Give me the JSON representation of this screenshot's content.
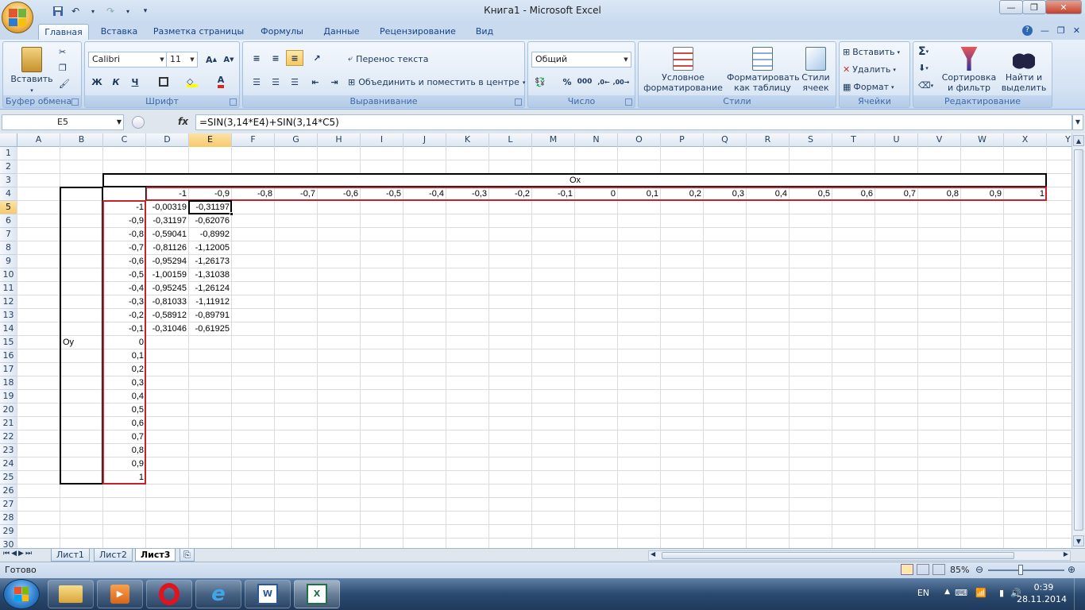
{
  "window": {
    "title": "Книга1 - Microsoft Excel"
  },
  "tabs": [
    "Главная",
    "Вставка",
    "Разметка страницы",
    "Формулы",
    "Данные",
    "Рецензирование",
    "Вид"
  ],
  "ribbon": {
    "clipboard": {
      "label": "Буфер обмена",
      "paste": "Вставить"
    },
    "font": {
      "label": "Шрифт",
      "name": "Calibri",
      "size": "11",
      "bold": "Ж",
      "italic": "К",
      "underline": "Ч"
    },
    "alignment": {
      "label": "Выравнивание",
      "wrap": "Перенос текста",
      "merge": "Объединить и поместить в центре"
    },
    "number": {
      "label": "Число",
      "format": "Общий",
      "percent": "%",
      "thousands": "000"
    },
    "styles": {
      "label": "Стили",
      "conditional": "Условное форматирование",
      "as_table": "Форматировать как таблицу",
      "cell_styles": "Стили ячеек"
    },
    "cells": {
      "label": "Ячейки",
      "insert": "Вставить",
      "delete": "Удалить",
      "format": "Формат"
    },
    "editing": {
      "label": "Редактирование",
      "sort": "Сортировка и фильтр",
      "find": "Найти и выделить"
    }
  },
  "formula_bar": {
    "name_box": "E5",
    "fx": "fx",
    "formula": "=SIN(3,14*E4)+SIN(3,14*C5)"
  },
  "columns": [
    "A",
    "B",
    "C",
    "D",
    "E",
    "F",
    "G",
    "H",
    "I",
    "J",
    "K",
    "L",
    "M",
    "N",
    "O",
    "P",
    "Q",
    "R",
    "S",
    "T",
    "U",
    "V",
    "W",
    "X",
    "Y"
  ],
  "rows": [
    "1",
    "2",
    "3",
    "4",
    "5",
    "6",
    "7",
    "8",
    "9",
    "10",
    "11",
    "12",
    "13",
    "14",
    "15",
    "16",
    "17",
    "18",
    "19",
    "20",
    "21",
    "22",
    "23",
    "24",
    "25",
    "26",
    "27",
    "28",
    "29",
    "30"
  ],
  "cells": {
    "ox_label": "Ox",
    "oy_label": "Oy",
    "x_values": [
      "-1",
      "-0,9",
      "-0,8",
      "-0,7",
      "-0,6",
      "-0,5",
      "-0,4",
      "-0,3",
      "-0,2",
      "-0,1",
      "0",
      "0,1",
      "0,2",
      "0,3",
      "0,4",
      "0,5",
      "0,6",
      "0,7",
      "0,8",
      "0,9",
      "1"
    ],
    "y_values": [
      "-1",
      "-0,9",
      "-0,8",
      "-0,7",
      "-0,6",
      "-0,5",
      "-0,4",
      "-0,3",
      "-0,2",
      "-0,1",
      "0",
      "0,1",
      "0,2",
      "0,3",
      "0,4",
      "0,5",
      "0,6",
      "0,7",
      "0,8",
      "0,9",
      "1"
    ],
    "col_d": [
      "-0,00319",
      "-0,31197",
      "-0,59041",
      "-0,81126",
      "-0,95294",
      "-1,00159",
      "-0,95245",
      "-0,81033",
      "-0,58912",
      "-0,31046"
    ],
    "col_e": [
      "-0,31197",
      "-0,62076",
      "-0,8992",
      "-1,12005",
      "-1,26173",
      "-1,31038",
      "-1,26124",
      "-1,11912",
      "-0,89791",
      "-0,61925"
    ]
  },
  "sheet_tabs": [
    "Лист1",
    "Лист2",
    "Лист3"
  ],
  "active_sheet": "Лист3",
  "status": {
    "ready": "Готово",
    "zoom": "85%"
  },
  "taskbar": {
    "lang": "EN",
    "time": "0:39",
    "date": "28.11.2014"
  }
}
